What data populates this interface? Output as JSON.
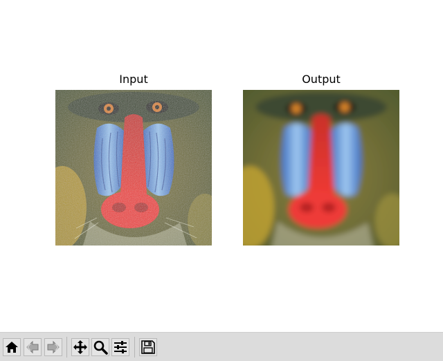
{
  "figure": {
    "panels": [
      {
        "id": "input",
        "title": "Input",
        "blurred": false
      },
      {
        "id": "output",
        "title": "Output",
        "blurred": true
      }
    ]
  },
  "toolbar": {
    "buttons": [
      {
        "name": "home-button",
        "icon": "home-icon",
        "enabled": true
      },
      {
        "name": "back-button",
        "icon": "back-arrow-icon",
        "enabled": false
      },
      {
        "name": "forward-button",
        "icon": "forward-arrow-icon",
        "enabled": false
      },
      {
        "name": "pan-button",
        "icon": "move-arrows-icon",
        "enabled": true
      },
      {
        "name": "zoom-button",
        "icon": "magnifier-icon",
        "enabled": true
      },
      {
        "name": "configure-subplots-button",
        "icon": "sliders-icon",
        "enabled": true
      },
      {
        "name": "save-button",
        "icon": "floppy-disk-icon",
        "enabled": true
      }
    ]
  },
  "colors": {
    "toolbar_bg": "#dcdcdc",
    "fur": "#6b6a35",
    "nose": "#e8302c",
    "cheek": "#5b8fd8",
    "eye": "#d8842a"
  }
}
